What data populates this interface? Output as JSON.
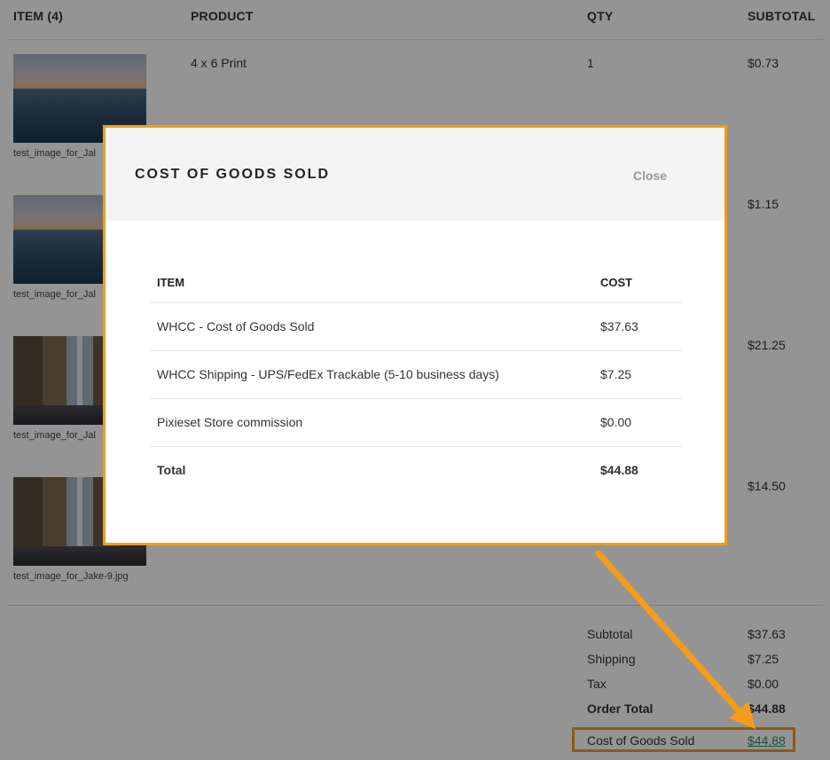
{
  "table": {
    "headers": {
      "item": "ITEM (4)",
      "product": "PRODUCT",
      "qty": "QTY",
      "subtotal": "SUBTOTAL"
    },
    "rows": [
      {
        "filename": "test_image_for_Jal",
        "product": "4 x 6 Print",
        "qty": "1",
        "subtotal": "$0.73",
        "image": "sea"
      },
      {
        "filename": "test_image_for_Jal",
        "product": "",
        "qty": "",
        "subtotal": "$1.15",
        "image": "sea"
      },
      {
        "filename": "test_image_for_Jal",
        "product": "",
        "qty": "",
        "subtotal": "$21.25",
        "image": "city"
      },
      {
        "filename": "test_image_for_Jake-9.jpg",
        "product": "",
        "qty": "",
        "subtotal": "$14.50",
        "image": "city"
      }
    ]
  },
  "summary": {
    "subtotal_label": "Subtotal",
    "subtotal_value": "$37.63",
    "shipping_label": "Shipping",
    "shipping_value": "$7.25",
    "tax_label": "Tax",
    "tax_value": "$0.00",
    "order_total_label": "Order Total",
    "order_total_value": "$44.88",
    "cogs_label": "Cost of Goods Sold",
    "cogs_value": "$44.88"
  },
  "modal": {
    "title": "COST OF GOODS SOLD",
    "close_label": "Close",
    "headers": {
      "item": "ITEM",
      "cost": "COST"
    },
    "rows": [
      {
        "item": "WHCC - Cost of Goods Sold",
        "cost": "$37.63"
      },
      {
        "item": "WHCC Shipping - UPS/FedEx Trackable (5-10 business days)",
        "cost": "$7.25"
      },
      {
        "item": "Pixieset Store commission",
        "cost": "$0.00"
      }
    ],
    "total": {
      "item": "Total",
      "cost": "$44.88"
    }
  },
  "colors": {
    "highlight": "#f59c1a",
    "link": "#2a8a63",
    "overlay": "rgba(0,0,0,0.42)"
  },
  "icons": {
    "annotation_arrow": "arrow-icon"
  }
}
